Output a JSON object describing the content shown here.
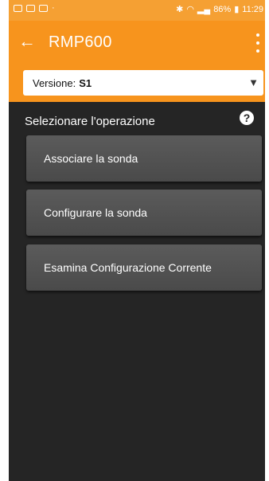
{
  "statusbar": {
    "left_dot": "·",
    "bluetooth_icon": "bluetooth",
    "battery": "86%",
    "time": "11:29"
  },
  "appbar": {
    "back_icon": "←",
    "title": "RMP600"
  },
  "version_select": {
    "label": "Versione:",
    "value": "S1",
    "arrow": "▼"
  },
  "section": {
    "label": "Selezionare l'operazione",
    "help_icon": "?"
  },
  "operations": [
    {
      "label": "Associare la sonda"
    },
    {
      "label": "Configurare la sonda"
    },
    {
      "label": "Esamina Configurazione Corrente"
    }
  ],
  "colors": {
    "accent": "#f7941d",
    "background": "#252525",
    "button": "#525252"
  }
}
